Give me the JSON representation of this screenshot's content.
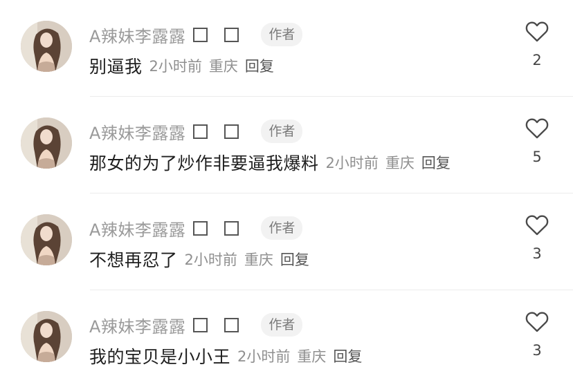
{
  "comments": [
    {
      "username": "A辣妹李露露",
      "author_tag": "作者",
      "content": "别逼我",
      "time": "2小时前",
      "location": "重庆",
      "reply_label": "回复",
      "likes": "2"
    },
    {
      "username": "A辣妹李露露",
      "author_tag": "作者",
      "content": "那女的为了炒作非要逼我爆料",
      "time": "2小时前",
      "location": "重庆",
      "reply_label": "回复",
      "likes": "5"
    },
    {
      "username": "A辣妹李露露",
      "author_tag": "作者",
      "content": "不想再忍了",
      "time": "2小时前",
      "location": "重庆",
      "reply_label": "回复",
      "likes": "3"
    },
    {
      "username": "A辣妹李露露",
      "author_tag": "作者",
      "content": "我的宝贝是小小王",
      "time": "2小时前",
      "location": "重庆",
      "reply_label": "回复",
      "likes": "3"
    }
  ],
  "icons": {
    "like": "heart-outline-icon",
    "badge": "empty-square-icon"
  },
  "colors": {
    "username": "#9a9a9a",
    "content": "#1e1e1e",
    "meta": "#8f8f8f",
    "author_tag_bg": "#f2f2f2"
  }
}
